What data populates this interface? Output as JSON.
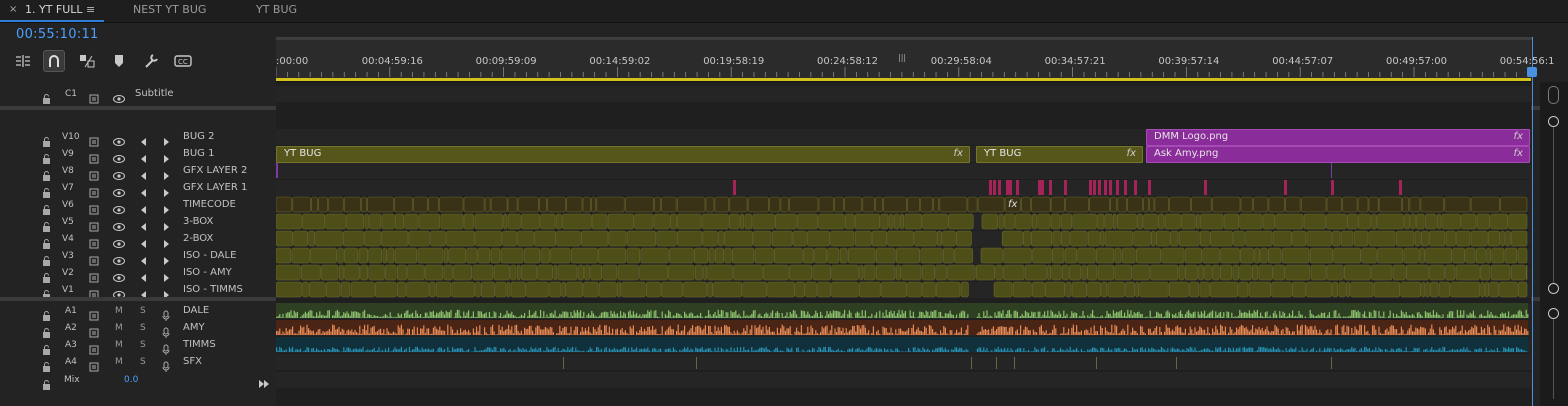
{
  "tabs": [
    {
      "label": "1. YT FULL",
      "active": true
    },
    {
      "label": "NEST YT BUG",
      "active": false
    },
    {
      "label": "YT BUG",
      "active": false
    }
  ],
  "timecode": "00:55:10:11",
  "tools": [
    {
      "icon": "insert-overwrite-icon",
      "active": false
    },
    {
      "icon": "snap-magnet-icon",
      "active": true
    },
    {
      "icon": "linked-selection-icon",
      "active": false
    },
    {
      "icon": "add-marker-icon",
      "active": false
    },
    {
      "icon": "wrench-settings-icon",
      "active": false
    },
    {
      "icon": "captions-icon",
      "active": false
    }
  ],
  "ruler": {
    "labels": [
      ":00:00",
      "00:04:59:16",
      "00:09:59:09",
      "00:14:59:02",
      "00:19:58:19",
      "00:24:58:12",
      "00:29:58:04",
      "00:34:57:21",
      "00:39:57:14",
      "00:44:57:07",
      "00:49:57:00",
      "00:54:56:1"
    ]
  },
  "caption_track": {
    "id": "C1",
    "name": "Subtitle"
  },
  "video_tracks": [
    {
      "id": "V10",
      "name": "BUG 2"
    },
    {
      "id": "V9",
      "name": "BUG 1"
    },
    {
      "id": "V8",
      "name": "GFX LAYER 2"
    },
    {
      "id": "V7",
      "name": "GFX LAYER 1"
    },
    {
      "id": "V6",
      "name": "TIMECODE"
    },
    {
      "id": "V5",
      "name": "3-BOX"
    },
    {
      "id": "V4",
      "name": "2-BOX"
    },
    {
      "id": "V3",
      "name": "ISO - DALE"
    },
    {
      "id": "V2",
      "name": "ISO - AMY"
    },
    {
      "id": "V1",
      "name": "ISO - TIMMS"
    }
  ],
  "audio_tracks": [
    {
      "id": "A1",
      "name": "DALE",
      "m": "M",
      "s": "S"
    },
    {
      "id": "A2",
      "name": "AMY",
      "m": "M",
      "s": "S"
    },
    {
      "id": "A3",
      "name": "TIMMS",
      "m": "M",
      "s": "S"
    },
    {
      "id": "A4",
      "name": "SFX",
      "m": "M",
      "s": "S"
    }
  ],
  "mix": {
    "label": "Mix",
    "value": "0.0"
  },
  "clips": {
    "v10": [
      {
        "name": "DMM Logo.png",
        "fx": "fx"
      }
    ],
    "v9": [
      {
        "name": "YT BUG",
        "fx": "fx"
      },
      {
        "name": "YT BUG",
        "fx": "fx"
      },
      {
        "name": "Ask Amy.png",
        "fx": "fx"
      }
    ],
    "v6_fx": "fx"
  },
  "colors": {
    "accent": "#4ba0ff",
    "video_clip": "#56561a",
    "graphic_clip": "#8a2c99",
    "marker_clip": "#a4245a",
    "audio_dale": "#8cc16d",
    "audio_amy": "#e58b58",
    "audio_timms": "#2a8fb0"
  }
}
